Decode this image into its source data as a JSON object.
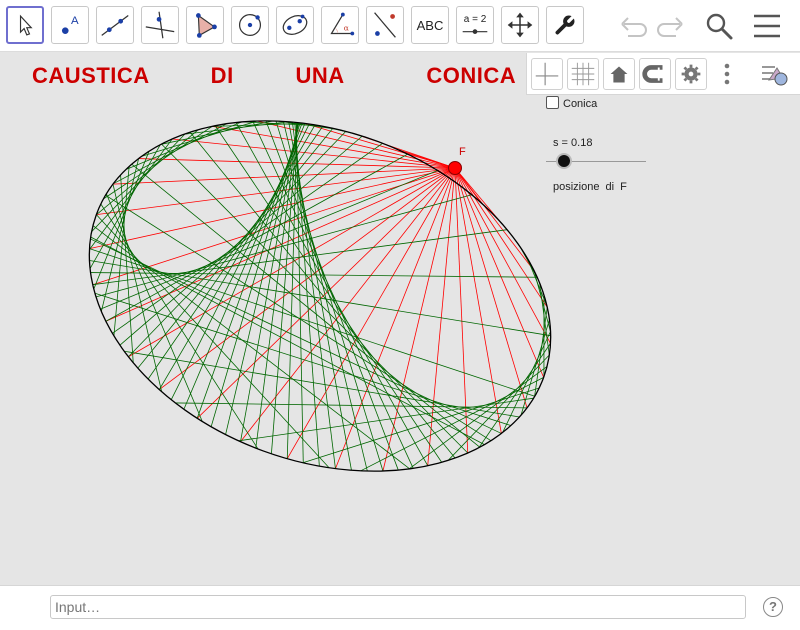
{
  "app": {
    "title": "CAUSTICA   DI   UNA    CONICA"
  },
  "toolbar": {
    "text_tool_label": "ABC",
    "slider_tool_label": "a = 2",
    "tools": [
      "move-tool",
      "point-tool",
      "line-tool",
      "perpendicular-tool",
      "polygon-tool",
      "circle-tool",
      "ellipse-tool",
      "angle-tool",
      "reflect-tool",
      "text-tool",
      "slider-tool",
      "move-graphics-tool",
      "tool-settings"
    ]
  },
  "graphics_menu": {
    "items": [
      "axes-toggle",
      "grid-toggle",
      "home-view",
      "point-capture",
      "graphics-settings",
      "more-options"
    ]
  },
  "objects": {
    "conic_checkbox_label": "Conica",
    "conic_checked": false,
    "slider_label": "s = 0.18",
    "slider_value": 0.18,
    "slider_caption": "posizione  di  F",
    "focus_label": "F"
  },
  "input": {
    "placeholder": "Input…",
    "help_symbol": "?"
  },
  "colors": {
    "title": "#cc0000",
    "reflected_rays": "#006600",
    "incident_rays": "#ff0000",
    "ellipse": "#000000",
    "point": "#ff0000",
    "active_tool_border": "#6f6fcf"
  }
}
